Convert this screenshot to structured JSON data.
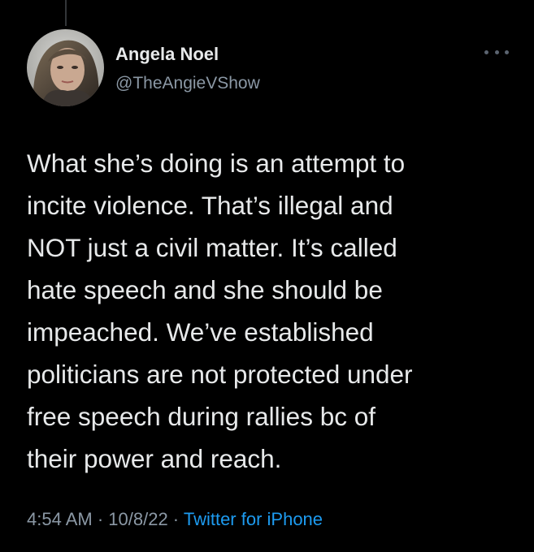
{
  "author": {
    "name": "Angela Noel",
    "handle": "@TheAngieVShow"
  },
  "tweet": {
    "text": "What she’s doing is an attempt to\nincite violence.  That’s illegal and\nNOT just a civil matter.  It’s called\nhate speech and she should be\nimpeached.  We’ve established\npoliticians are not protected under\nfree speech during rallies bc of\ntheir power and reach."
  },
  "meta": {
    "time": "4:54 AM",
    "separator": " · ",
    "date": "10/8/22",
    "separator2": " · ",
    "source": "Twitter for iPhone"
  },
  "icons": {
    "more": "more-options-icon",
    "avatar": "profile-avatar"
  },
  "colors": {
    "background": "#000000",
    "text": "#e7e9ea",
    "secondary": "#8b98a5",
    "link": "#1d9bf0"
  }
}
